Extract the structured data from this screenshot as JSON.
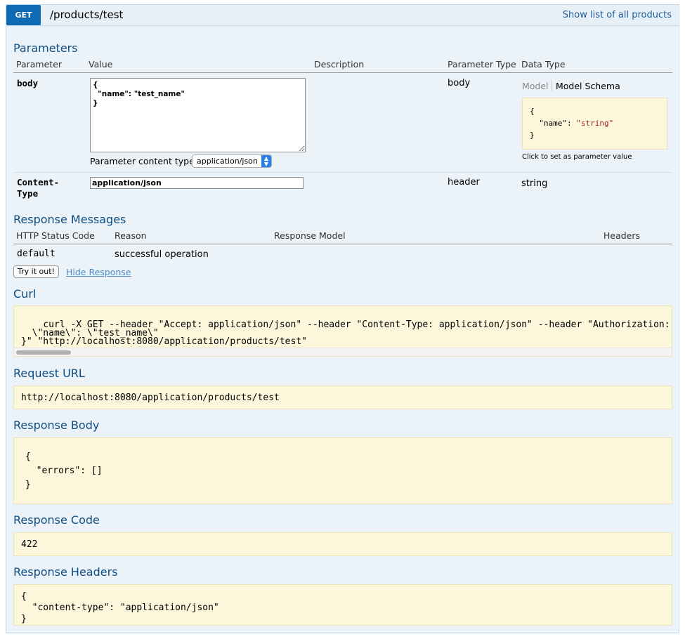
{
  "header": {
    "method": "GET",
    "path": "/products/test",
    "show_link": "Show list of all products"
  },
  "parameters": {
    "title": "Parameters",
    "columns": [
      "Parameter",
      "Value",
      "Description",
      "Parameter Type",
      "Data Type"
    ],
    "rows": [
      {
        "name": "body",
        "value": "{\n  \"name\": \"test_name\"\n}",
        "content_type_label": "Parameter content type:",
        "content_type_value": "application/json",
        "param_type": "body",
        "tab_model": "Model",
        "tab_schema": "Model Schema",
        "schema_open": "{",
        "schema_key": "  \"name\": ",
        "schema_val": "\"string\"",
        "schema_close": "}",
        "hint": "Click to set as parameter value"
      },
      {
        "name": "Content-\nType",
        "value": "application/json",
        "param_type": "header",
        "data_type": "string"
      }
    ]
  },
  "responses": {
    "title": "Response Messages",
    "columns": [
      "HTTP Status Code",
      "Reason",
      "Response Model",
      "Headers"
    ],
    "rows": [
      {
        "code": "default",
        "reason": "successful operation"
      }
    ]
  },
  "actions": {
    "try_label": "Try it out!",
    "hide_label": "Hide Response"
  },
  "curl": {
    "title": "Curl",
    "text": "curl -X GET --header \"Accept: application/json\" --header \"Content-Type: application/json\" --header \"Authorization: Bear\n  \\\"name\\\": \\\"test_name\\\"\n}\" \"http://localhost:8080/application/products/test\""
  },
  "request_url": {
    "title": "Request URL",
    "text": "http://localhost:8080/application/products/test"
  },
  "response_body": {
    "title": "Response Body",
    "text": "{\n  \"errors\": []\n}"
  },
  "response_code": {
    "title": "Response Code",
    "text": "422"
  },
  "response_headers": {
    "title": "Response Headers",
    "text": "{\n  \"content-type\": \"application/json\"\n}"
  },
  "colors": {
    "method_badge": "#0f6ab4",
    "section_heading": "#0f4d82",
    "panel_background": "#ebf3f9",
    "code_box_background": "#fcf6db",
    "link": "#1f5e99"
  }
}
